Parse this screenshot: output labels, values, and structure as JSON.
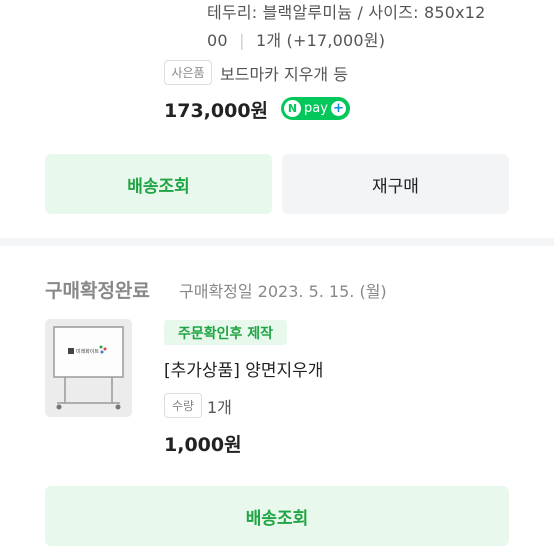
{
  "item1": {
    "option_line1": "테두리: 블랙알루미늄 / 사이즈: 850x12",
    "option_line2": "00",
    "option_qty": "1개 (+17,000원)",
    "gift_badge": "사은품",
    "gift_text": "보드마카 지우개 등",
    "price": "173,000원",
    "npay_label": "pay",
    "npay_n": "N",
    "npay_plus": "+",
    "btn_track": "배송조회",
    "btn_reorder": "재구매"
  },
  "item2": {
    "status": "구매확정완료",
    "confirm_date": "구매확정일 2023. 5. 15. (월)",
    "tag": "주문확인후 제작",
    "name": "[추가상품] 양면지우개",
    "qty_badge": "수량",
    "qty": "1개",
    "price": "1,000원",
    "btn_track": "배송조회",
    "thumb_logo_text": "미래화이트"
  },
  "colors": {
    "accent_green": "#20a544",
    "button_green_bg": "#e9f8ec",
    "npay_green": "#03c75a",
    "gray_button_bg": "#f3f4f5"
  }
}
